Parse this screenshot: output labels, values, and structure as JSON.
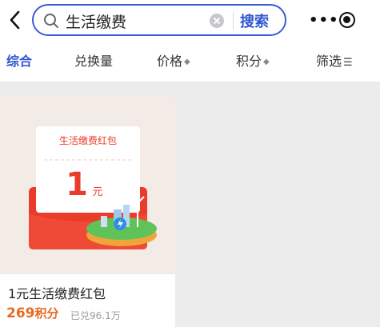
{
  "search": {
    "query": "生活缴费",
    "button_label": "搜索"
  },
  "header": {
    "more_label": "•••"
  },
  "filters": {
    "tabs": [
      {
        "label": "综合"
      },
      {
        "label": "兑换量"
      },
      {
        "label": "价格"
      },
      {
        "label": "积分"
      },
      {
        "label": "筛选"
      }
    ],
    "sort_symbol": "◆",
    "filter_symbol": "☰"
  },
  "product": {
    "banner_text": "生活缴费红包",
    "amount": "1",
    "amount_unit": "元",
    "title": "1元生活缴费红包",
    "points": "269",
    "points_unit": "积分",
    "redeemed": "已兑96.1万"
  },
  "colors": {
    "accent": "#2f55d4",
    "points": "#e86a20",
    "envelope_red": "#e93c2b"
  },
  "icons": [
    "back-icon",
    "search-icon",
    "clear-icon",
    "more-icon",
    "target-icon",
    "sort-icon",
    "filter-icon"
  ]
}
